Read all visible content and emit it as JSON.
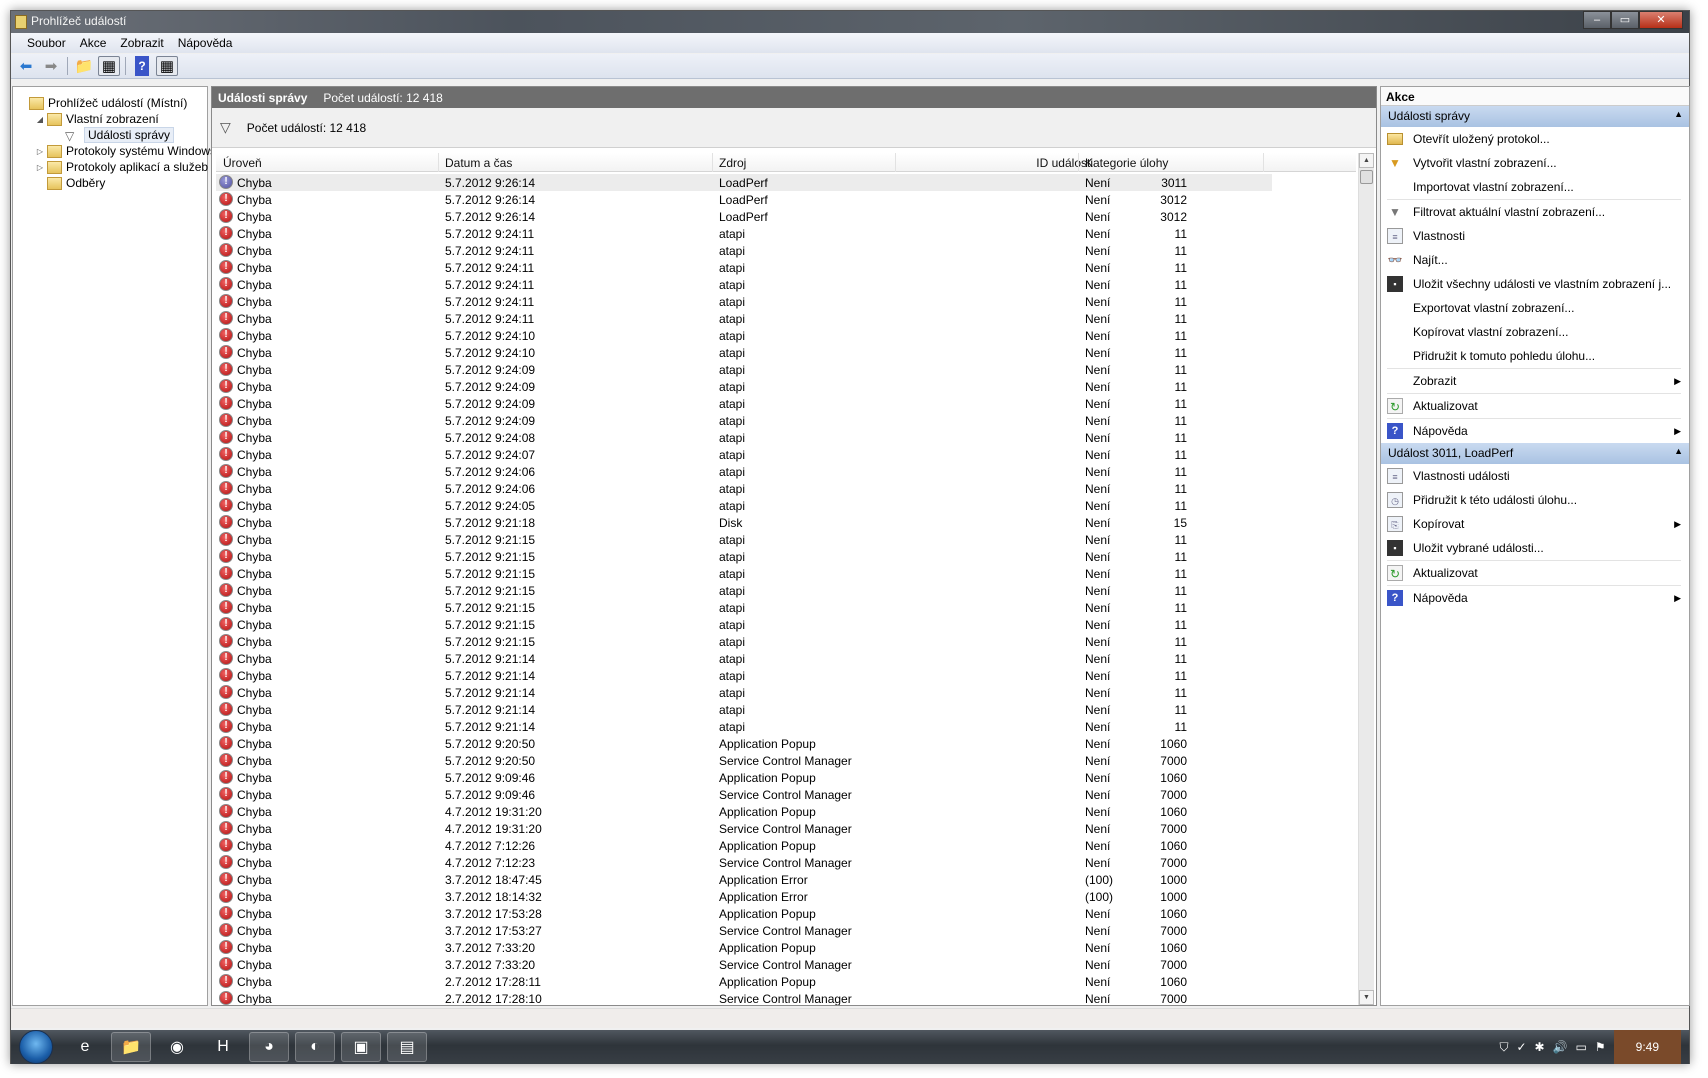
{
  "window": {
    "title": "Prohlížeč událostí",
    "controls": [
      "–",
      "▭",
      "✕"
    ]
  },
  "menu": [
    "Soubor",
    "Akce",
    "Zobrazit",
    "Nápověda"
  ],
  "toolbar": [
    {
      "icon": "back-arrow-icon",
      "glyph": "⬅"
    },
    {
      "icon": "forward-arrow-icon",
      "glyph": "➡"
    },
    {
      "icon": "up-folder-icon",
      "glyph": "📁"
    },
    {
      "icon": "show-hide-tree-icon",
      "glyph": "▦"
    },
    {
      "icon": "help-icon",
      "glyph": "?"
    },
    {
      "icon": "show-hide-action-pane-icon",
      "glyph": "▦"
    }
  ],
  "tree": [
    {
      "label": "Prohlížeč událostí (Místní)",
      "level": 0,
      "expander": ""
    },
    {
      "label": "Vlastní zobrazení",
      "level": 1,
      "expander": "◢"
    },
    {
      "label": "Události správy",
      "level": 2,
      "expander": "",
      "selected": true
    },
    {
      "label": "Protokoly systému Windows",
      "level": 1,
      "expander": "▷"
    },
    {
      "label": "Protokoly aplikací a služeb",
      "level": 1,
      "expander": "▷"
    },
    {
      "label": "Odběry",
      "level": 1,
      "expander": ""
    }
  ],
  "center": {
    "title": "Události správy",
    "count_label": "Počet událostí: 12 418",
    "filter_count": "Počet událostí: 12 418"
  },
  "table": {
    "columns": [
      "Úroveň",
      "Datum a čas",
      "Zdroj",
      "ID události",
      "Kategorie úlohy"
    ],
    "rows": [
      [
        "Chyba",
        "5.7.2012 9:26:14",
        "LoadPerf",
        "3011",
        "Není"
      ],
      [
        "Chyba",
        "5.7.2012 9:26:14",
        "LoadPerf",
        "3012",
        "Není"
      ],
      [
        "Chyba",
        "5.7.2012 9:26:14",
        "LoadPerf",
        "3012",
        "Není"
      ],
      [
        "Chyba",
        "5.7.2012 9:24:11",
        "atapi",
        "11",
        "Není"
      ],
      [
        "Chyba",
        "5.7.2012 9:24:11",
        "atapi",
        "11",
        "Není"
      ],
      [
        "Chyba",
        "5.7.2012 9:24:11",
        "atapi",
        "11",
        "Není"
      ],
      [
        "Chyba",
        "5.7.2012 9:24:11",
        "atapi",
        "11",
        "Není"
      ],
      [
        "Chyba",
        "5.7.2012 9:24:11",
        "atapi",
        "11",
        "Není"
      ],
      [
        "Chyba",
        "5.7.2012 9:24:11",
        "atapi",
        "11",
        "Není"
      ],
      [
        "Chyba",
        "5.7.2012 9:24:10",
        "atapi",
        "11",
        "Není"
      ],
      [
        "Chyba",
        "5.7.2012 9:24:10",
        "atapi",
        "11",
        "Není"
      ],
      [
        "Chyba",
        "5.7.2012 9:24:09",
        "atapi",
        "11",
        "Není"
      ],
      [
        "Chyba",
        "5.7.2012 9:24:09",
        "atapi",
        "11",
        "Není"
      ],
      [
        "Chyba",
        "5.7.2012 9:24:09",
        "atapi",
        "11",
        "Není"
      ],
      [
        "Chyba",
        "5.7.2012 9:24:09",
        "atapi",
        "11",
        "Není"
      ],
      [
        "Chyba",
        "5.7.2012 9:24:08",
        "atapi",
        "11",
        "Není"
      ],
      [
        "Chyba",
        "5.7.2012 9:24:07",
        "atapi",
        "11",
        "Není"
      ],
      [
        "Chyba",
        "5.7.2012 9:24:06",
        "atapi",
        "11",
        "Není"
      ],
      [
        "Chyba",
        "5.7.2012 9:24:06",
        "atapi",
        "11",
        "Není"
      ],
      [
        "Chyba",
        "5.7.2012 9:24:05",
        "atapi",
        "11",
        "Není"
      ],
      [
        "Chyba",
        "5.7.2012 9:21:18",
        "Disk",
        "15",
        "Není"
      ],
      [
        "Chyba",
        "5.7.2012 9:21:15",
        "atapi",
        "11",
        "Není"
      ],
      [
        "Chyba",
        "5.7.2012 9:21:15",
        "atapi",
        "11",
        "Není"
      ],
      [
        "Chyba",
        "5.7.2012 9:21:15",
        "atapi",
        "11",
        "Není"
      ],
      [
        "Chyba",
        "5.7.2012 9:21:15",
        "atapi",
        "11",
        "Není"
      ],
      [
        "Chyba",
        "5.7.2012 9:21:15",
        "atapi",
        "11",
        "Není"
      ],
      [
        "Chyba",
        "5.7.2012 9:21:15",
        "atapi",
        "11",
        "Není"
      ],
      [
        "Chyba",
        "5.7.2012 9:21:15",
        "atapi",
        "11",
        "Není"
      ],
      [
        "Chyba",
        "5.7.2012 9:21:14",
        "atapi",
        "11",
        "Není"
      ],
      [
        "Chyba",
        "5.7.2012 9:21:14",
        "atapi",
        "11",
        "Není"
      ],
      [
        "Chyba",
        "5.7.2012 9:21:14",
        "atapi",
        "11",
        "Není"
      ],
      [
        "Chyba",
        "5.7.2012 9:21:14",
        "atapi",
        "11",
        "Není"
      ],
      [
        "Chyba",
        "5.7.2012 9:21:14",
        "atapi",
        "11",
        "Není"
      ],
      [
        "Chyba",
        "5.7.2012 9:20:50",
        "Application Popup",
        "1060",
        "Není"
      ],
      [
        "Chyba",
        "5.7.2012 9:20:50",
        "Service Control Manager",
        "7000",
        "Není"
      ],
      [
        "Chyba",
        "5.7.2012 9:09:46",
        "Application Popup",
        "1060",
        "Není"
      ],
      [
        "Chyba",
        "5.7.2012 9:09:46",
        "Service Control Manager",
        "7000",
        "Není"
      ],
      [
        "Chyba",
        "4.7.2012 19:31:20",
        "Application Popup",
        "1060",
        "Není"
      ],
      [
        "Chyba",
        "4.7.2012 19:31:20",
        "Service Control Manager",
        "7000",
        "Není"
      ],
      [
        "Chyba",
        "4.7.2012 7:12:26",
        "Application Popup",
        "1060",
        "Není"
      ],
      [
        "Chyba",
        "4.7.2012 7:12:23",
        "Service Control Manager",
        "7000",
        "Není"
      ],
      [
        "Chyba",
        "3.7.2012 18:47:45",
        "Application Error",
        "1000",
        "(100)"
      ],
      [
        "Chyba",
        "3.7.2012 18:14:32",
        "Application Error",
        "1000",
        "(100)"
      ],
      [
        "Chyba",
        "3.7.2012 17:53:28",
        "Application Popup",
        "1060",
        "Není"
      ],
      [
        "Chyba",
        "3.7.2012 17:53:27",
        "Service Control Manager",
        "7000",
        "Není"
      ],
      [
        "Chyba",
        "3.7.2012 7:33:20",
        "Application Popup",
        "1060",
        "Není"
      ],
      [
        "Chyba",
        "3.7.2012 7:33:20",
        "Service Control Manager",
        "7000",
        "Není"
      ],
      [
        "Chyba",
        "2.7.2012 17:28:11",
        "Application Popup",
        "1060",
        "Není"
      ],
      [
        "Chyba",
        "2.7.2012 17:28:10",
        "Service Control Manager",
        "7000",
        "Není"
      ]
    ],
    "selected_row": 0
  },
  "actions": {
    "title": "Akce",
    "sections": [
      {
        "title": "Události správy",
        "items": [
          {
            "label": "Otevřít uložený protokol...",
            "icon": "open-folder-icon",
            "cls": "folder",
            "glyph": ""
          },
          {
            "label": "Vytvořit vlastní zobrazení...",
            "icon": "create-filter-icon",
            "cls": "funnel2",
            "glyph": "▼"
          },
          {
            "label": "Importovat vlastní zobrazení...",
            "icon": "",
            "cls": "",
            "glyph": "",
            "sep": true
          },
          {
            "label": "Filtrovat aktuální vlastní zobrazení...",
            "icon": "filter-icon",
            "cls": "funnel",
            "glyph": "▼"
          },
          {
            "label": "Vlastnosti",
            "icon": "properties-icon",
            "cls": "prop",
            "glyph": "≡"
          },
          {
            "label": "Najít...",
            "icon": "binoculars-icon",
            "cls": "",
            "glyph": "👓"
          },
          {
            "label": "Uložit všechny události ve vlastním zobrazení j...",
            "icon": "save-icon",
            "cls": "save",
            "glyph": "▪"
          },
          {
            "label": "Exportovat vlastní zobrazení...",
            "icon": "",
            "cls": "",
            "glyph": ""
          },
          {
            "label": "Kopírovat vlastní zobrazení...",
            "icon": "",
            "cls": "",
            "glyph": ""
          },
          {
            "label": "Přidružit k tomuto pohledu úlohu...",
            "icon": "",
            "cls": "",
            "glyph": "",
            "sep": true
          },
          {
            "label": "Zobrazit",
            "icon": "",
            "cls": "",
            "glyph": "",
            "submenu": true,
            "sep": true
          },
          {
            "label": "Aktualizovat",
            "icon": "refresh-icon",
            "cls": "refresh",
            "glyph": "↻",
            "sep": true
          },
          {
            "label": "Nápověda",
            "icon": "help-icon",
            "cls": "help",
            "glyph": "?",
            "submenu": true
          }
        ]
      },
      {
        "title": "Událost 3011, LoadPerf",
        "items": [
          {
            "label": "Vlastnosti události",
            "icon": "event-properties-icon",
            "cls": "prop",
            "glyph": "≡"
          },
          {
            "label": "Přidružit k této události úlohu...",
            "icon": "task-clock-icon",
            "cls": "prop",
            "glyph": "◷"
          },
          {
            "label": "Kopírovat",
            "icon": "copy-icon",
            "cls": "prop",
            "glyph": "⎘",
            "submenu": true
          },
          {
            "label": "Uložit vybrané události...",
            "icon": "save-icon",
            "cls": "save",
            "glyph": "▪",
            "sep": true
          },
          {
            "label": "Aktualizovat",
            "icon": "refresh-icon",
            "cls": "refresh",
            "glyph": "↻",
            "sep": true
          },
          {
            "label": "Nápověda",
            "icon": "help-icon",
            "cls": "help",
            "glyph": "?",
            "submenu": true
          }
        ]
      }
    ]
  },
  "taskbar": {
    "apps": [
      {
        "icon": "internet-explorer-icon",
        "glyph": "e",
        "open": false
      },
      {
        "icon": "file-explorer-icon",
        "glyph": "📁",
        "open": true
      },
      {
        "icon": "avast-icon",
        "glyph": "◉",
        "open": false
      },
      {
        "icon": "app-h-icon",
        "glyph": "H",
        "open": false
      },
      {
        "icon": "firefox-icon",
        "glyph": "◕",
        "open": true
      },
      {
        "icon": "app-lens-icon",
        "glyph": "◐",
        "open": true
      },
      {
        "icon": "remote-desktop-icon",
        "glyph": "▣",
        "open": true
      },
      {
        "icon": "event-viewer-icon",
        "glyph": "▤",
        "open": true
      }
    ],
    "tray": [
      {
        "icon": "shield-icon",
        "glyph": "⛉"
      },
      {
        "icon": "network-check-icon",
        "glyph": "✓"
      },
      {
        "icon": "app-tray-icon",
        "glyph": "✱"
      },
      {
        "icon": "volume-icon",
        "glyph": "🔊"
      },
      {
        "icon": "network-icon",
        "glyph": "▭"
      },
      {
        "icon": "action-center-flag-icon",
        "glyph": "⚑"
      }
    ],
    "clock": "9:49"
  }
}
